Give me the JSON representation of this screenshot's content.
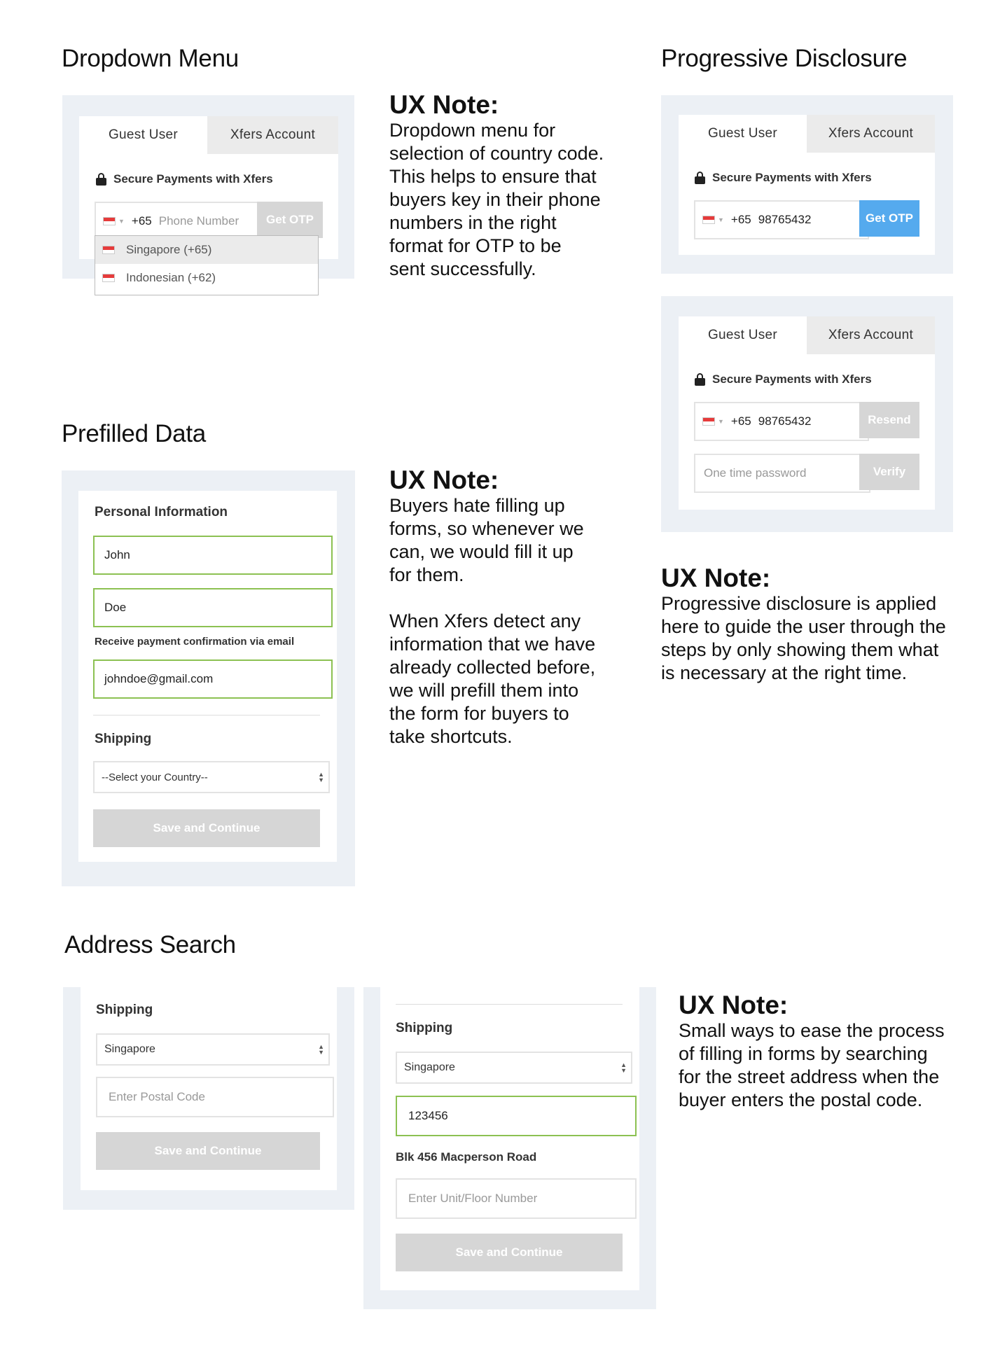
{
  "sections": {
    "dropdown_menu": "Dropdown Menu",
    "progressive_disclosure": "Progressive Disclosure",
    "prefilled_data": "Prefilled Data",
    "address_search": "Address Search"
  },
  "notes": {
    "dropdown": {
      "title": "UX Note:",
      "body": "Dropdown menu for\nselection of country code.\nThis helps to ensure that\nbuyers key in their phone\nnumbers in the right\nformat for OTP to be\nsent successfully."
    },
    "prefilled": {
      "title": "UX Note:",
      "body": "Buyers hate filling up\nforms, so whenever we\ncan, we would fill it up\nfor them.\n\nWhen Xfers detect any\ninformation that we have\nalready collected before,\nwe will prefill them into\nthe form for buyers to\ntake shortcuts."
    },
    "progressive": {
      "title": "UX Note:",
      "body": "Progressive disclosure is applied\nhere to guide the user through the\nsteps by only showing them what\nis necessary at the right time."
    },
    "address": {
      "title": "UX Note:",
      "body": "Small ways to ease the process\nof filling in forms by searching\nfor the street address when the\nbuyer enters the postal code."
    }
  },
  "common": {
    "tab_guest": "Guest User",
    "tab_xfers": "Xfers Account",
    "secure": "Secure Payments with Xfers",
    "country_code": "+65",
    "phone_placeholder": "Phone Number",
    "phone_value": "98765432",
    "get_otp": "Get OTP",
    "resend": "Resend",
    "otp_placeholder": "One time password",
    "verify": "Verify",
    "save_continue": "Save and Continue",
    "flag_icon": "singapore-flag-icon",
    "accent_green": "#8cc152",
    "accent_blue": "#55aaee"
  },
  "dropdown": {
    "options": [
      "Singapore (+65)",
      "Indonesian (+62)"
    ]
  },
  "prefilled": {
    "personal_heading": "Personal Information",
    "first_name": "John",
    "last_name": "Doe",
    "email_label": "Receive payment confirmation via email",
    "email": "johndoe@gmail.com",
    "shipping_heading": "Shipping",
    "country_placeholder": "--Select your Country--"
  },
  "address": {
    "shipping_heading": "Shipping",
    "country": "Singapore",
    "postal_placeholder": "Enter Postal Code",
    "postal_value": "123456",
    "street": "Blk 456 Macperson Road",
    "unit_placeholder": "Enter Unit/Floor Number"
  }
}
